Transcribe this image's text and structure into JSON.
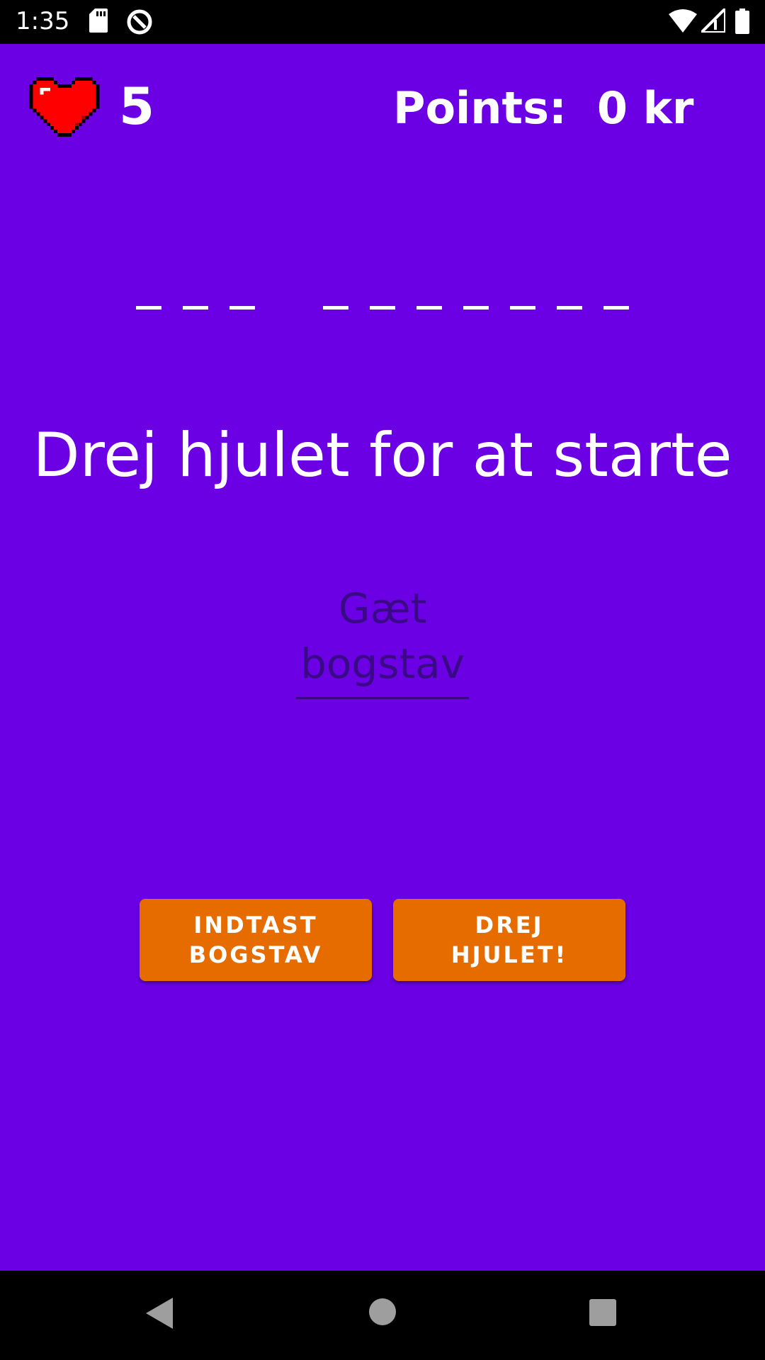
{
  "status_bar": {
    "time": "1:35",
    "icons": [
      "sd-card-icon",
      "data-saver-icon",
      "wifi-icon",
      "signal-icon",
      "battery-icon"
    ]
  },
  "game": {
    "lives": "5",
    "points_label": "Points:  0 kr",
    "word_groups": [
      3,
      7
    ],
    "message": "Drej hjulet for at starte",
    "guess_field": {
      "value": "",
      "placeholder_line1": "Gæt",
      "placeholder_line2": "bogstav"
    },
    "buttons": {
      "enter_letter": {
        "line1": "INDTAST",
        "line2": "BOGSTAV"
      },
      "spin_wheel": {
        "line1": "DREJ",
        "line2": "HJULET!"
      }
    }
  },
  "colors": {
    "background": "#6a00e3",
    "button": "#e66c00",
    "hint_text": "#3a0a86",
    "heart": "#ff0000"
  },
  "nav_bar": {
    "icons": [
      "back-icon",
      "home-icon",
      "recents-icon"
    ]
  }
}
